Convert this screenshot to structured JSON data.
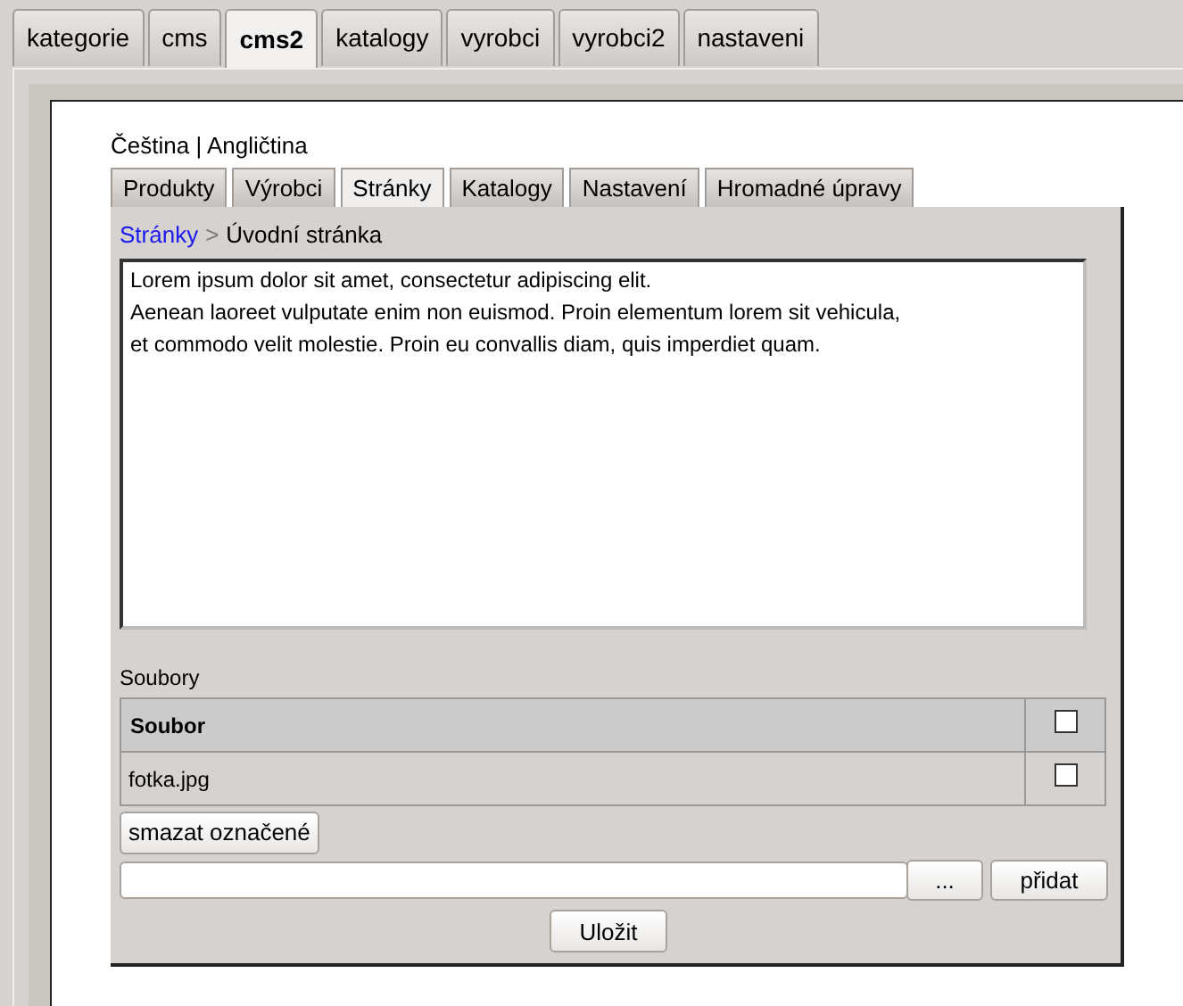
{
  "top_tabs": [
    {
      "label": "kategorie",
      "selected": false
    },
    {
      "label": "cms",
      "selected": false
    },
    {
      "label": "cms2",
      "selected": true
    },
    {
      "label": "katalogy",
      "selected": false
    },
    {
      "label": "vyrobci",
      "selected": false
    },
    {
      "label": "vyrobci2",
      "selected": false
    },
    {
      "label": "nastaveni",
      "selected": false
    }
  ],
  "languages": "Čeština | Angličtina",
  "sub_tabs": [
    {
      "label": "Produkty",
      "selected": false
    },
    {
      "label": "Výrobci",
      "selected": false
    },
    {
      "label": "Stránky",
      "selected": true
    },
    {
      "label": "Katalogy",
      "selected": false
    },
    {
      "label": "Nastavení",
      "selected": false
    },
    {
      "label": "Hromadné úpravy",
      "selected": false
    }
  ],
  "breadcrumb": {
    "link": "Stránky",
    "separator": ">",
    "current": "Úvodní stránka"
  },
  "editor": {
    "lines": [
      "Lorem ipsum dolor sit amet, consectetur adipiscing elit.",
      "Aenean laoreet vulputate enim non euismod. Proin elementum lorem sit vehicula,",
      "et commodo velit molestie. Proin eu convallis diam, quis imperdiet quam."
    ]
  },
  "files": {
    "title": "Soubory",
    "header": {
      "label": "Soubor",
      "checked": false
    },
    "rows": [
      {
        "name": "fotka.jpg",
        "checked": false
      }
    ]
  },
  "delete_button": "smazat označené",
  "browse_button": "...",
  "add_button": "přidat",
  "save_button": "Uložit"
}
